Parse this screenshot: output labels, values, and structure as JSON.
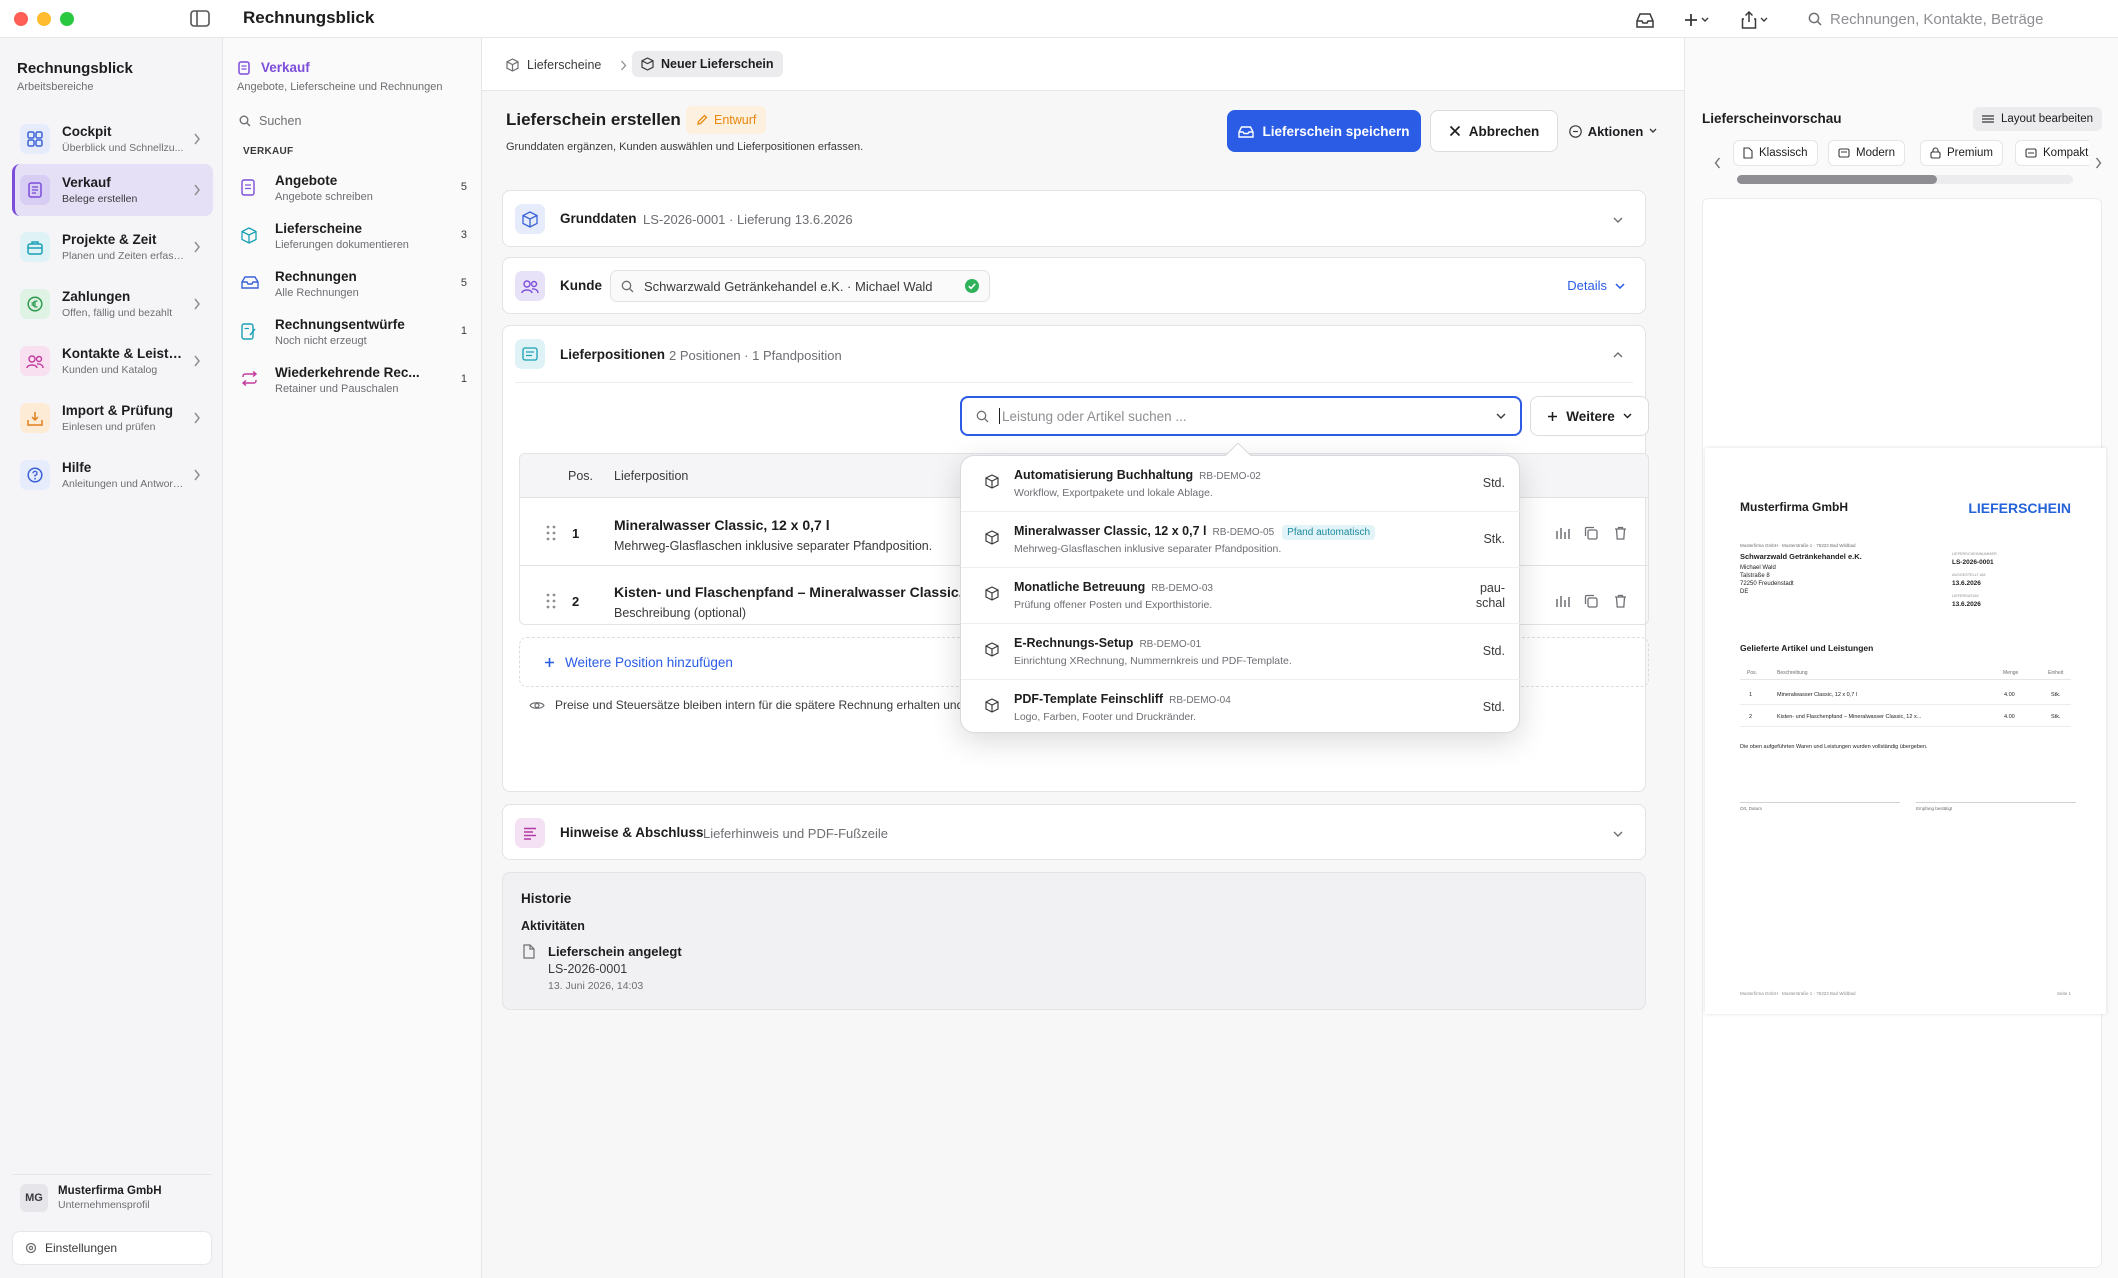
{
  "app": {
    "title": "Rechnungsblick"
  },
  "toolbar": {
    "search_placeholder": "Rechnungen, Kontakte, Beträge"
  },
  "sidebar": {
    "workspace_title": "Rechnungsblick",
    "workspace_sub": "Arbeitsbereiche",
    "items": [
      {
        "label": "Cockpit",
        "sub": "Überblick und Schnellzu..."
      },
      {
        "label": "Verkauf",
        "sub": "Belege erstellen"
      },
      {
        "label": "Projekte & Zeit",
        "sub": "Planen und Zeiten erfass..."
      },
      {
        "label": "Zahlungen",
        "sub": "Offen, fällig und bezahlt"
      },
      {
        "label": "Kontakte & Leistung...",
        "sub": "Kunden und Katalog"
      },
      {
        "label": "Import & Prüfung",
        "sub": "Einlesen und prüfen"
      },
      {
        "label": "Hilfe",
        "sub": "Anleitungen und Antwort..."
      }
    ],
    "org_initials": "MG",
    "org_name": "Musterfirma GmbH",
    "org_sub": "Unternehmensprofil",
    "settings": "Einstellungen"
  },
  "subnav": {
    "title": "Verkauf",
    "subtitle": "Angebote, Lieferscheine und Rechnungen",
    "search_placeholder": "Suchen",
    "section": "VERKAUF",
    "items": [
      {
        "label": "Angebote",
        "sub": "Angebote schreiben",
        "count": "5"
      },
      {
        "label": "Lieferscheine",
        "sub": "Lieferungen dokumentieren",
        "count": "3"
      },
      {
        "label": "Rechnungen",
        "sub": "Alle Rechnungen",
        "count": "5"
      },
      {
        "label": "Rechnungsentwürfe",
        "sub": "Noch nicht erzeugt",
        "count": "1"
      },
      {
        "label": "Wiederkehrende Rec...",
        "sub": "Retainer und Pauschalen",
        "count": "1"
      }
    ]
  },
  "breadcrumb": {
    "parent": "Lieferscheine",
    "current": "Neuer Lieferschein"
  },
  "header": {
    "title": "Lieferschein erstellen",
    "badge": "Entwurf",
    "subtitle": "Grunddaten ergänzen, Kunden auswählen und Lieferpositionen erfassen.",
    "save": "Lieferschein speichern",
    "cancel": "Abbrechen",
    "actions": "Aktionen"
  },
  "grunddaten": {
    "title": "Grunddaten",
    "summary": "LS-2026-0001 · Lieferung 13.6.2026"
  },
  "kunde": {
    "title": "Kunde",
    "value": "Schwarzwald Getränkehandel e.K. · Michael Wald",
    "details": "Details"
  },
  "positions": {
    "title": "Lieferpositionen",
    "summary": "2 Positionen · 1 Pfandposition",
    "search_placeholder": "Leistung oder Artikel suchen ...",
    "more": "Weitere",
    "col_pos": "Pos.",
    "col_item": "Lieferposition",
    "rows": [
      {
        "pos": "1",
        "name": "Mineralwasser Classic, 12 x 0,7 l",
        "desc": "Mehrweg-Glasflaschen inklusive separater Pfandposition."
      },
      {
        "pos": "2",
        "name": "Kisten- und Flaschenpfand – Mineralwasser Classic, 12 x",
        "desc": "Beschreibung (optional)"
      }
    ],
    "add": "Weitere Position hinzufügen",
    "note": "Preise und Steuersätze bleiben intern für die spätere Rechnung erhalten und erscheinen nicht auf dem Lieferschein."
  },
  "dropdown": [
    {
      "name": "Automatisierung Buchhaltung",
      "code": "RB-DEMO-02",
      "desc": "Workflow, Exportpakete und lokale Ablage.",
      "unit": "Std.",
      "badge": ""
    },
    {
      "name": "Mineralwasser Classic, 12 x 0,7 l",
      "code": "RB-DEMO-05",
      "desc": "Mehrweg-Glasflaschen inklusive separater Pfandposition.",
      "unit": "Stk.",
      "badge": "Pfand automatisch"
    },
    {
      "name": "Monatliche Betreuung",
      "code": "RB-DEMO-03",
      "desc": "Prüfung offener Posten und Exporthistorie.",
      "unit": "pau-\nschal",
      "badge": ""
    },
    {
      "name": "E-Rechnungs-Setup",
      "code": "RB-DEMO-01",
      "desc": "Einrichtung XRechnung, Nummernkreis und PDF-Template.",
      "unit": "Std.",
      "badge": ""
    },
    {
      "name": "PDF-Template Feinschliff",
      "code": "RB-DEMO-04",
      "desc": "Logo, Farben, Footer und Druckränder.",
      "unit": "Std.",
      "badge": ""
    }
  ],
  "hinweise": {
    "title": "Hinweise & Abschluss",
    "summary": "Lieferhinweis und PDF-Fußzeile"
  },
  "historie": {
    "title": "Historie",
    "activities": "Aktivitäten",
    "entry_title": "Lieferschein angelegt",
    "entry_ref": "LS-2026-0001",
    "entry_time": "13. Juni 2026, 14:03"
  },
  "preview": {
    "title": "Lieferscheinvorschau",
    "layout_button": "Layout bearbeiten",
    "templates": [
      "Klassisch",
      "Modern",
      "Premium",
      "Kompakt"
    ],
    "doc": {
      "company": "Musterfirma GmbH",
      "doctype": "LIEFERSCHEIN",
      "sender_line": "Musterfirma GmbH · Musterstraße 1 · 75323 Bad Wildbad",
      "customer": "Schwarzwald Getränkehandel e.K.",
      "contact": "Michael Wald",
      "street": "Talstraße 8",
      "city": "72250 Freudenstadt",
      "country": "DE",
      "lbl_number": "LIEFERSCHEINNUMMER",
      "number": "LS-2026-0001",
      "lbl_issued": "AUSGESTELLT AM",
      "issued": "13.6.2026",
      "lbl_delivery": "LIEFERDATUM",
      "delivery": "13.6.2026",
      "section": "Gelieferte Artikel und Leistungen",
      "th_pos": "Pos.",
      "th_desc": "Beschreibung",
      "th_qty": "Menge",
      "th_unit": "Einheit",
      "rows": [
        {
          "pos": "1",
          "desc": "Mineralwasser Classic, 12 x 0,7 l",
          "qty": "4.00",
          "unit": "Stk."
        },
        {
          "pos": "2",
          "desc": "Kisten- und Flaschenpfand – Mineralwasser Classic, 12 x...",
          "qty": "4.00",
          "unit": "Stk."
        }
      ],
      "confirm": "Die oben aufgeführten Waren und Leistungen wurden vollständig übergeben.",
      "sig_left": "Ort, Datum",
      "sig_right": "Empfang bestätigt",
      "footer_left": "Musterfirma GmbH · Musterstraße 1 · 75323 Bad Wildbad",
      "footer_right": "Seite 1"
    }
  },
  "colors": {
    "accent": "#2a5ce6",
    "brand_purple": "#7c4ddb",
    "draft": "#e8870e",
    "doc_blue": "#2563d8"
  }
}
